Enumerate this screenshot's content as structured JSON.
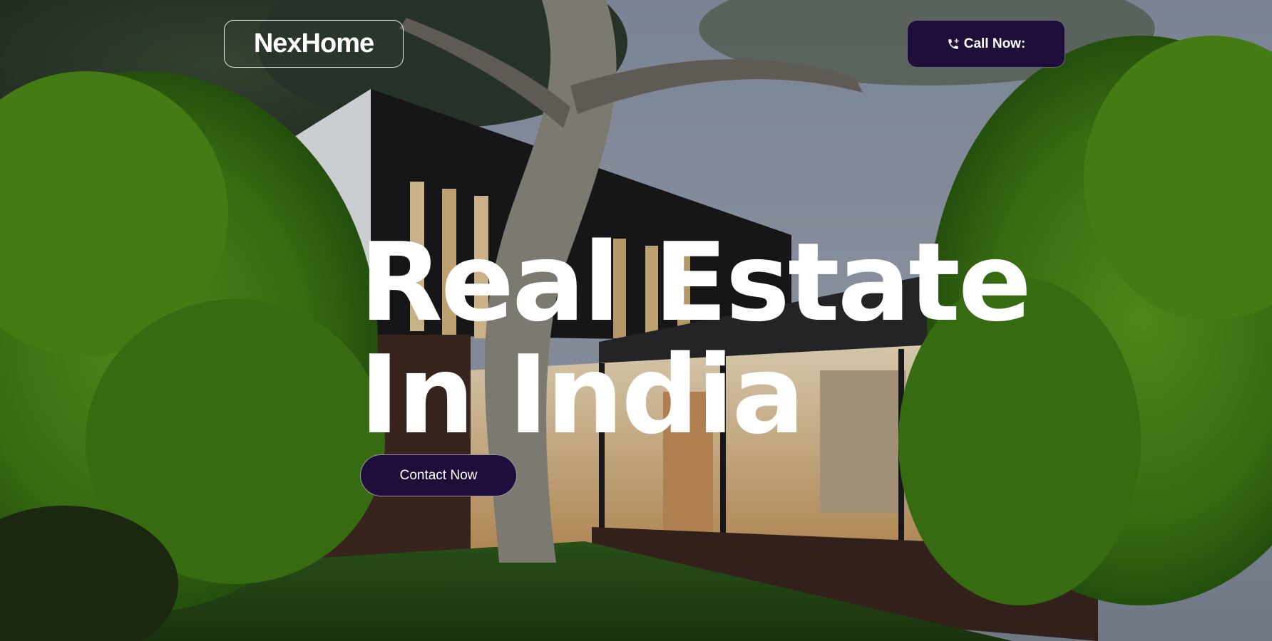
{
  "header": {
    "brand": "NexHome",
    "call_button": {
      "label": "Call Now:",
      "icon": "phone-add-icon"
    }
  },
  "hero": {
    "title_line1": "Real Estate",
    "title_line2": "In India",
    "cta_label": "Contact Now"
  },
  "colors": {
    "accent": "#1f0e3a",
    "text": "#ffffff"
  }
}
